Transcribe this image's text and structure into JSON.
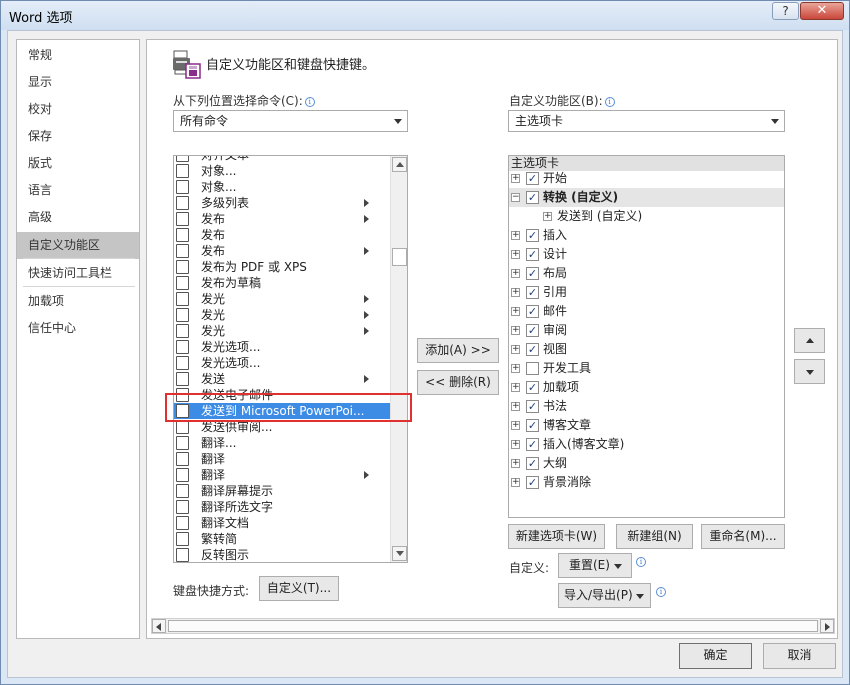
{
  "window": {
    "title": "Word 选项",
    "help": "?",
    "close": "✕"
  },
  "nav": {
    "items": [
      "常规",
      "显示",
      "校对",
      "保存",
      "版式",
      "语言",
      "高级",
      "自定义功能区",
      "快速访问工具栏",
      "加载项",
      "信任中心"
    ],
    "selected_index": 7
  },
  "header": {
    "text": "自定义功能区和键盘快捷键。"
  },
  "left": {
    "choose_label": "从下列位置选择命令(C):",
    "choose_value": "所有命令",
    "commands": [
      {
        "label": "对齐文本",
        "submenu": false
      },
      {
        "label": "对象...",
        "submenu": false
      },
      {
        "label": "对象...",
        "submenu": false
      },
      {
        "label": "多级列表",
        "submenu": true
      },
      {
        "label": "发布",
        "submenu": true
      },
      {
        "label": "发布",
        "submenu": false
      },
      {
        "label": "发布",
        "submenu": true
      },
      {
        "label": "发布为 PDF 或 XPS",
        "submenu": false
      },
      {
        "label": "发布为草稿",
        "submenu": false
      },
      {
        "label": "发光",
        "submenu": true
      },
      {
        "label": "发光",
        "submenu": true
      },
      {
        "label": "发光",
        "submenu": true
      },
      {
        "label": "发光选项...",
        "submenu": false
      },
      {
        "label": "发光选项...",
        "submenu": false
      },
      {
        "label": "发送",
        "submenu": true
      },
      {
        "label": "发送电子邮件",
        "submenu": false
      },
      {
        "label": "发送到 Microsoft PowerPoi...",
        "submenu": false
      },
      {
        "label": "发送供审阅...",
        "submenu": false
      },
      {
        "label": "翻译...",
        "submenu": false
      },
      {
        "label": "翻译",
        "submenu": false
      },
      {
        "label": "翻译",
        "submenu": true
      },
      {
        "label": "翻译屏幕提示",
        "submenu": false
      },
      {
        "label": "翻译所选文字",
        "submenu": false
      },
      {
        "label": "翻译文档",
        "submenu": false
      },
      {
        "label": "繁转简",
        "submenu": false
      },
      {
        "label": "反转图示",
        "submenu": false
      }
    ],
    "selected_index": 16,
    "keyboard_label": "键盘快捷方式:",
    "keyboard_button": "自定义(T)..."
  },
  "middle": {
    "add_button": "添加(A) >>",
    "remove_button": "<< 删除(R)"
  },
  "right": {
    "customize_label": "自定义功能区(B):",
    "customize_value": "主选项卡",
    "tree_header": "主选项卡",
    "tabs": [
      {
        "label": "开始",
        "checked": true,
        "expand": "+",
        "level": 0
      },
      {
        "label": "转换 (自定义)",
        "checked": true,
        "expand": "−",
        "level": 0,
        "bold": true
      },
      {
        "label": "发送到 (自定义)",
        "checked": null,
        "expand": "+",
        "level": 1
      },
      {
        "label": "插入",
        "checked": true,
        "expand": "+",
        "level": 0
      },
      {
        "label": "设计",
        "checked": true,
        "expand": "+",
        "level": 0
      },
      {
        "label": "布局",
        "checked": true,
        "expand": "+",
        "level": 0
      },
      {
        "label": "引用",
        "checked": true,
        "expand": "+",
        "level": 0
      },
      {
        "label": "邮件",
        "checked": true,
        "expand": "+",
        "level": 0
      },
      {
        "label": "审阅",
        "checked": true,
        "expand": "+",
        "level": 0
      },
      {
        "label": "视图",
        "checked": true,
        "expand": "+",
        "level": 0
      },
      {
        "label": "开发工具",
        "checked": false,
        "expand": "+",
        "level": 0
      },
      {
        "label": "加载项",
        "checked": true,
        "expand": "+",
        "level": 0
      },
      {
        "label": "书法",
        "checked": true,
        "expand": "+",
        "level": 0
      },
      {
        "label": "博客文章",
        "checked": true,
        "expand": "+",
        "level": 0
      },
      {
        "label": "插入(博客文章)",
        "checked": true,
        "expand": "+",
        "level": 0
      },
      {
        "label": "大纲",
        "checked": true,
        "expand": "+",
        "level": 0
      },
      {
        "label": "背景消除",
        "checked": true,
        "expand": "+",
        "level": 0
      }
    ],
    "new_tab_button": "新建选项卡(W)",
    "new_group_button": "新建组(N)",
    "rename_button": "重命名(M)...",
    "customize_reset_label": "自定义:",
    "reset_button": "重置(E)",
    "import_export_button": "导入/导出(P)"
  },
  "footer": {
    "ok_button": "确定",
    "cancel_button": "取消"
  }
}
